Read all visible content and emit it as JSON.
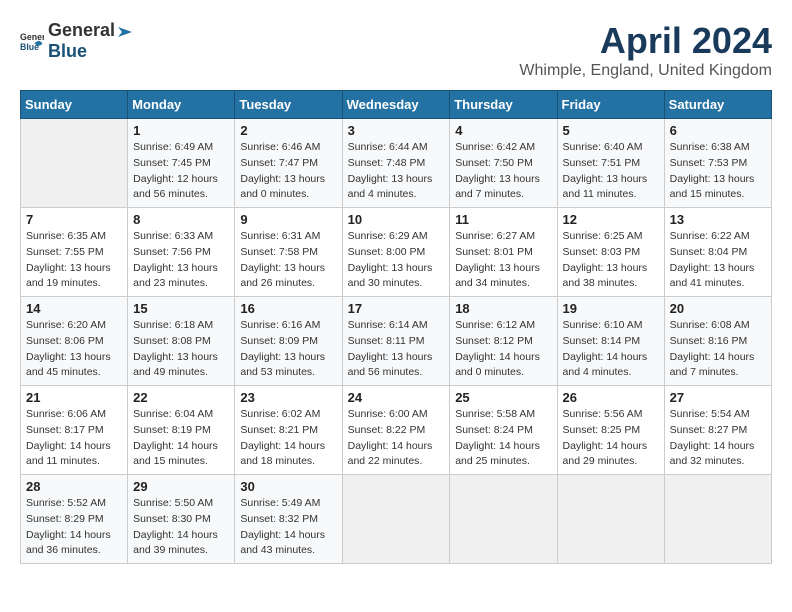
{
  "app": {
    "name_general": "General",
    "name_blue": "Blue"
  },
  "header": {
    "title": "April 2024",
    "subtitle": "Whimple, England, United Kingdom"
  },
  "calendar": {
    "days_of_week": [
      "Sunday",
      "Monday",
      "Tuesday",
      "Wednesday",
      "Thursday",
      "Friday",
      "Saturday"
    ],
    "weeks": [
      [
        {
          "day": "",
          "detail": ""
        },
        {
          "day": "1",
          "detail": "Sunrise: 6:49 AM\nSunset: 7:45 PM\nDaylight: 12 hours\nand 56 minutes."
        },
        {
          "day": "2",
          "detail": "Sunrise: 6:46 AM\nSunset: 7:47 PM\nDaylight: 13 hours\nand 0 minutes."
        },
        {
          "day": "3",
          "detail": "Sunrise: 6:44 AM\nSunset: 7:48 PM\nDaylight: 13 hours\nand 4 minutes."
        },
        {
          "day": "4",
          "detail": "Sunrise: 6:42 AM\nSunset: 7:50 PM\nDaylight: 13 hours\nand 7 minutes."
        },
        {
          "day": "5",
          "detail": "Sunrise: 6:40 AM\nSunset: 7:51 PM\nDaylight: 13 hours\nand 11 minutes."
        },
        {
          "day": "6",
          "detail": "Sunrise: 6:38 AM\nSunset: 7:53 PM\nDaylight: 13 hours\nand 15 minutes."
        }
      ],
      [
        {
          "day": "7",
          "detail": "Sunrise: 6:35 AM\nSunset: 7:55 PM\nDaylight: 13 hours\nand 19 minutes."
        },
        {
          "day": "8",
          "detail": "Sunrise: 6:33 AM\nSunset: 7:56 PM\nDaylight: 13 hours\nand 23 minutes."
        },
        {
          "day": "9",
          "detail": "Sunrise: 6:31 AM\nSunset: 7:58 PM\nDaylight: 13 hours\nand 26 minutes."
        },
        {
          "day": "10",
          "detail": "Sunrise: 6:29 AM\nSunset: 8:00 PM\nDaylight: 13 hours\nand 30 minutes."
        },
        {
          "day": "11",
          "detail": "Sunrise: 6:27 AM\nSunset: 8:01 PM\nDaylight: 13 hours\nand 34 minutes."
        },
        {
          "day": "12",
          "detail": "Sunrise: 6:25 AM\nSunset: 8:03 PM\nDaylight: 13 hours\nand 38 minutes."
        },
        {
          "day": "13",
          "detail": "Sunrise: 6:22 AM\nSunset: 8:04 PM\nDaylight: 13 hours\nand 41 minutes."
        }
      ],
      [
        {
          "day": "14",
          "detail": "Sunrise: 6:20 AM\nSunset: 8:06 PM\nDaylight: 13 hours\nand 45 minutes."
        },
        {
          "day": "15",
          "detail": "Sunrise: 6:18 AM\nSunset: 8:08 PM\nDaylight: 13 hours\nand 49 minutes."
        },
        {
          "day": "16",
          "detail": "Sunrise: 6:16 AM\nSunset: 8:09 PM\nDaylight: 13 hours\nand 53 minutes."
        },
        {
          "day": "17",
          "detail": "Sunrise: 6:14 AM\nSunset: 8:11 PM\nDaylight: 13 hours\nand 56 minutes."
        },
        {
          "day": "18",
          "detail": "Sunrise: 6:12 AM\nSunset: 8:12 PM\nDaylight: 14 hours\nand 0 minutes."
        },
        {
          "day": "19",
          "detail": "Sunrise: 6:10 AM\nSunset: 8:14 PM\nDaylight: 14 hours\nand 4 minutes."
        },
        {
          "day": "20",
          "detail": "Sunrise: 6:08 AM\nSunset: 8:16 PM\nDaylight: 14 hours\nand 7 minutes."
        }
      ],
      [
        {
          "day": "21",
          "detail": "Sunrise: 6:06 AM\nSunset: 8:17 PM\nDaylight: 14 hours\nand 11 minutes."
        },
        {
          "day": "22",
          "detail": "Sunrise: 6:04 AM\nSunset: 8:19 PM\nDaylight: 14 hours\nand 15 minutes."
        },
        {
          "day": "23",
          "detail": "Sunrise: 6:02 AM\nSunset: 8:21 PM\nDaylight: 14 hours\nand 18 minutes."
        },
        {
          "day": "24",
          "detail": "Sunrise: 6:00 AM\nSunset: 8:22 PM\nDaylight: 14 hours\nand 22 minutes."
        },
        {
          "day": "25",
          "detail": "Sunrise: 5:58 AM\nSunset: 8:24 PM\nDaylight: 14 hours\nand 25 minutes."
        },
        {
          "day": "26",
          "detail": "Sunrise: 5:56 AM\nSunset: 8:25 PM\nDaylight: 14 hours\nand 29 minutes."
        },
        {
          "day": "27",
          "detail": "Sunrise: 5:54 AM\nSunset: 8:27 PM\nDaylight: 14 hours\nand 32 minutes."
        }
      ],
      [
        {
          "day": "28",
          "detail": "Sunrise: 5:52 AM\nSunset: 8:29 PM\nDaylight: 14 hours\nand 36 minutes."
        },
        {
          "day": "29",
          "detail": "Sunrise: 5:50 AM\nSunset: 8:30 PM\nDaylight: 14 hours\nand 39 minutes."
        },
        {
          "day": "30",
          "detail": "Sunrise: 5:49 AM\nSunset: 8:32 PM\nDaylight: 14 hours\nand 43 minutes."
        },
        {
          "day": "",
          "detail": ""
        },
        {
          "day": "",
          "detail": ""
        },
        {
          "day": "",
          "detail": ""
        },
        {
          "day": "",
          "detail": ""
        }
      ]
    ]
  }
}
